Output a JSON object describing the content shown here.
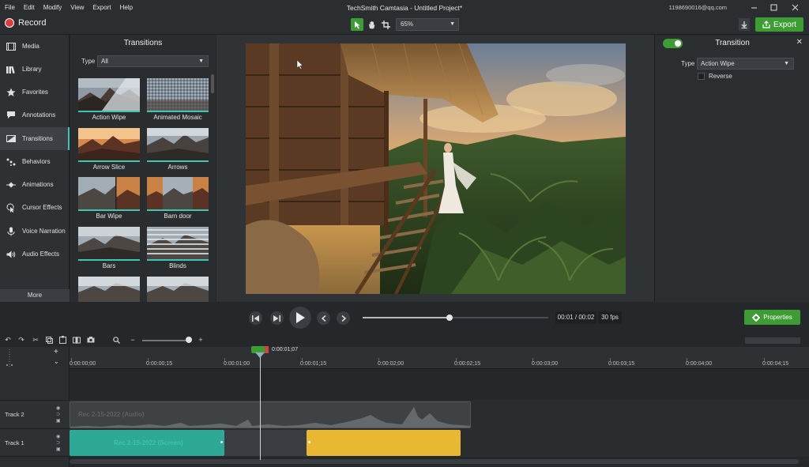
{
  "menus": [
    "File",
    "Edit",
    "Modify",
    "View",
    "Export",
    "Help"
  ],
  "app_title": "TechSmith Camtasia - Untitled Project*",
  "account": "1198690016@qq.com",
  "toolbar": {
    "record_label": "Record",
    "zoom_value": "65%",
    "export_label": "Export"
  },
  "sidebar": {
    "items": [
      {
        "label": "Media",
        "icon": "film-icon"
      },
      {
        "label": "Library",
        "icon": "library-icon"
      },
      {
        "label": "Favorites",
        "icon": "star-icon"
      },
      {
        "label": "Annotations",
        "icon": "annotation-icon"
      },
      {
        "label": "Transitions",
        "icon": "transition-icon"
      },
      {
        "label": "Behaviors",
        "icon": "behaviors-icon"
      },
      {
        "label": "Animations",
        "icon": "animations-icon"
      },
      {
        "label": "Cursor Effects",
        "icon": "cursor-icon"
      },
      {
        "label": "Voice Narration",
        "icon": "microphone-icon"
      },
      {
        "label": "Audio Effects",
        "icon": "speaker-icon"
      }
    ],
    "more_label": "More",
    "active_index": 4
  },
  "transitions_panel": {
    "title": "Transitions",
    "type_label": "Type",
    "type_value": "All",
    "thumbs": [
      "Action Wipe",
      "Animated Mosaic",
      "Arrow Slice",
      "Arrows",
      "Bar Wipe",
      "Barn door",
      "Bars",
      "Blinds",
      "",
      ""
    ]
  },
  "properties_panel": {
    "title": "Transition",
    "type_label": "Type",
    "type_value": "Action Wipe",
    "reverse_label": "Reverse",
    "close_glyph": "✕"
  },
  "playback": {
    "time": "00:01 / 00:02",
    "fps": "30 fps",
    "progress": 0.47,
    "properties_label": "Properties"
  },
  "timeline": {
    "playhead_label": "0:00:01;07",
    "ticks": [
      "0:00:00;00",
      "0:00:00;15",
      "0:00:01;00",
      "0:00:01;15",
      "0:00:02;00",
      "0:00:02;15",
      "0:00:03;00",
      "0:00:03;15",
      "0:00:04;00",
      "0:00:04;15"
    ],
    "tracks": [
      {
        "name": "Track 2",
        "clip_label": "Rec 2-15-2022 (Audio)"
      },
      {
        "name": "Track 1",
        "clip_label": "Rec 2-15-2022 (Screen)"
      }
    ]
  },
  "colors": {
    "accent_green": "#3e9c34",
    "teal": "#3ec6b0",
    "clip_yellow": "#e8b833"
  }
}
